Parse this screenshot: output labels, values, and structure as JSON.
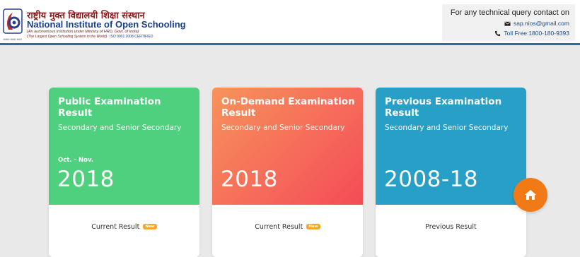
{
  "header": {
    "logo": {
      "hindi_name": "राष्ट्रीय मुक्त विद्यालयी शिक्षा संस्थान",
      "english_name_prefix": "National Institute of ",
      "english_name_highlight": "Open Schooling",
      "subtitle1": "(An autonomous institution under  Ministry of HRD, Govt. of India)",
      "subtitle2": "(The Largest Open Schooling System in the World)",
      "iso": "ISO 9001:2008 CERTIFIED",
      "tagline": "आकाश सबका समान"
    },
    "contact": {
      "title": "For any technical query contact on",
      "email": "sap.nios@gmail.com",
      "phone": "Toll Free:1800-180-9393",
      "email_icon": "envelope-icon",
      "phone_icon": "phone-icon"
    }
  },
  "cards": [
    {
      "title": "Public Examination Result",
      "subtitle": "Secondary and Senior Secondary",
      "season": "Oct. - Nov.",
      "year": "2018",
      "link_label": "Current Result",
      "badge": "New",
      "color": "#4fd07e"
    },
    {
      "title": "On-Demand Examination Result",
      "subtitle": "Secondary and Senior Secondary",
      "season": "",
      "year": "2018",
      "link_label": "Current Result",
      "badge": "New",
      "color": "#f66c5a"
    },
    {
      "title": "Previous Examination Result",
      "subtitle": "Secondary and Senior Secondary",
      "season": "",
      "year": "2008-18",
      "link_label": "Previous Result",
      "badge": "",
      "color": "#279fc7"
    }
  ],
  "fab": {
    "icon": "home-icon",
    "color": "#f27a16"
  },
  "colors": {
    "header_border": "#2f6aa8",
    "page_bg": "#e9e9e9",
    "badge": "#f5a623"
  }
}
